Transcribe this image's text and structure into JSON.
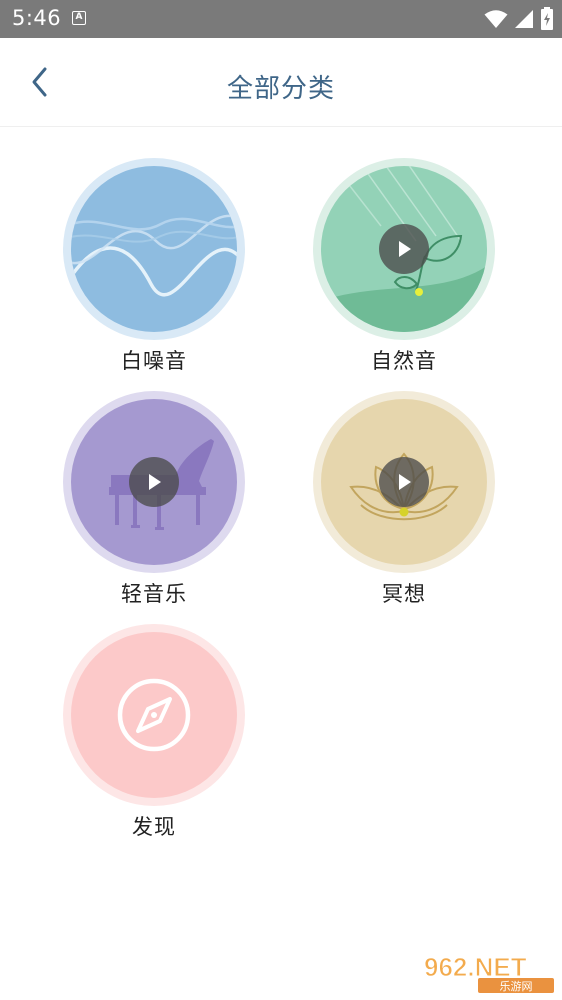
{
  "status_bar": {
    "time": "5:46",
    "app_icon_letter": "A"
  },
  "header": {
    "title": "全部分类"
  },
  "categories": [
    {
      "label": "白噪音",
      "icon": "wave-art"
    },
    {
      "label": "自然音",
      "icon": "leaf-art"
    },
    {
      "label": "轻音乐",
      "icon": "piano-art"
    },
    {
      "label": "冥想",
      "icon": "lotus-art"
    },
    {
      "label": "发现",
      "icon": "compass-icon"
    }
  ],
  "watermark": {
    "main": "962.NET",
    "sub": "乐游网"
  },
  "colors": {
    "status_bar": "#7a7a7a",
    "title": "#3f6688",
    "white_noise": "#8ebce0",
    "nature": "#8fd0b4",
    "light_music": "#a599d0",
    "meditation": "#e6d6ad",
    "discover": "#fcc9c9"
  }
}
